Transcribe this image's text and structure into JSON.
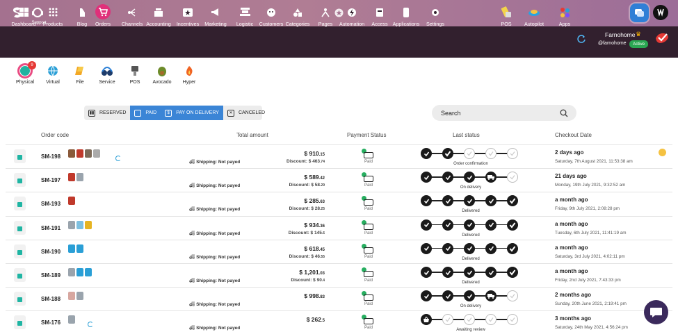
{
  "topbar": {
    "support_label": "Support"
  },
  "nav": {
    "items": [
      {
        "label": "Dashboard",
        "icon": "dashboard-icon"
      },
      {
        "label": "Products",
        "icon": "products-icon"
      },
      {
        "label": "Blog",
        "icon": "blog-icon"
      },
      {
        "label": "Orders",
        "icon": "orders-cart-icon",
        "active": true
      },
      {
        "label": "Channels",
        "icon": "channels-icon"
      },
      {
        "label": "Accounting",
        "icon": "accounting-icon"
      },
      {
        "label": "Incentives",
        "icon": "incentives-icon"
      },
      {
        "label": "Marketing",
        "icon": "marketing-icon"
      },
      {
        "label": "Logistic",
        "icon": "logistic-icon"
      },
      {
        "label": "Customers",
        "icon": "customers-icon"
      },
      {
        "label": "Categories",
        "icon": "categories-icon"
      },
      {
        "label": "Pages",
        "icon": "pages-icon"
      },
      {
        "label": "Automation",
        "icon": "automation-icon"
      },
      {
        "label": "Access",
        "icon": "access-icon"
      },
      {
        "label": "Applications",
        "icon": "applications-icon"
      },
      {
        "label": "Settings",
        "icon": "settings-icon"
      },
      {
        "label": "POS",
        "icon": "pos-icon"
      },
      {
        "label": "Autopilot",
        "icon": "autopilot-icon"
      },
      {
        "label": "Apps",
        "icon": "apps-icon"
      }
    ],
    "accent": "#e0307a"
  },
  "user": {
    "name": "Farnohome",
    "handle": "@farnohome",
    "status": "Active"
  },
  "sub_nav": {
    "items": [
      {
        "label": "Physical",
        "badge": "9"
      },
      {
        "label": "Virtual"
      },
      {
        "label": "File"
      },
      {
        "label": "Service"
      },
      {
        "label": "POS"
      },
      {
        "label": "Avocado"
      },
      {
        "label": "Hyper"
      }
    ]
  },
  "filters": {
    "reserved": "RESERVED",
    "paid": "PAID",
    "pay_on_delivery": "PAY ON DELIVERY",
    "canceled": "CANCELED"
  },
  "search": {
    "placeholder": "Search"
  },
  "table": {
    "headers": {
      "order_code": "Order code",
      "total_amount": "Total amount",
      "payment_status": "Payment Status",
      "last_status": "Last status",
      "checkout_date": "Checkout Date"
    },
    "rows": [
      {
        "code": "SM-198",
        "shipping_label": "Shipping:",
        "shipping_value": "Not payed",
        "amount": "$ 910",
        "amount_cents": ".15",
        "discount": "Discount: $ 463",
        "discount_cents": ".74",
        "payment": "Paid",
        "status_label": "Order confirmation",
        "steps": [
          "done",
          "done-check",
          "todo",
          "todo",
          "todo"
        ],
        "ago": "2 days ago",
        "date": "Saturday, 7th August 2021, 11:53:38 am"
      },
      {
        "code": "SM-197",
        "shipping_label": "Shipping:",
        "shipping_value": "Not payed",
        "amount": "$ 589",
        "amount_cents": ".42",
        "discount": "Discount: $ 58",
        "discount_cents": ".29",
        "payment": "Paid",
        "status_label": "On delivery",
        "steps": [
          "done",
          "done",
          "done",
          "truck",
          "todo"
        ],
        "ago": "21 days ago",
        "date": "Monday, 19th July 2021, 9:32:52 am"
      },
      {
        "code": "SM-193",
        "shipping_label": "Shipping:",
        "shipping_value": "Not payed",
        "amount": "$ 285",
        "amount_cents": ".63",
        "discount": "Discount: $ 28",
        "discount_cents": ".25",
        "payment": "Paid",
        "status_label": "Delivered",
        "steps": [
          "done",
          "done",
          "done",
          "done",
          "done-check"
        ],
        "ago": "a month ago",
        "date": "Friday, 9th July 2021, 2:08:28 pm"
      },
      {
        "code": "SM-191",
        "shipping_label": "Shipping:",
        "shipping_value": "Not payed",
        "amount": "$ 934",
        "amount_cents": ".36",
        "discount": "Discount: $ 145",
        "discount_cents": ".6",
        "payment": "Paid",
        "status_label": "Delivered",
        "steps": [
          "done",
          "done",
          "done",
          "done",
          "done-check"
        ],
        "ago": "a month ago",
        "date": "Tuesday, 6th July 2021, 11:41:19 am"
      },
      {
        "code": "SM-190",
        "shipping_label": "Shipping:",
        "shipping_value": "Not payed",
        "amount": "$ 618",
        "amount_cents": ".45",
        "discount": "Discount: $ 46",
        "discount_cents": ".55",
        "payment": "Paid",
        "status_label": "Delivered",
        "steps": [
          "done",
          "done",
          "done",
          "done",
          "done-check"
        ],
        "ago": "a month ago",
        "date": "Saturday, 3rd July 2021, 4:02:11 pm"
      },
      {
        "code": "SM-189",
        "shipping_label": "Shipping:",
        "shipping_value": "Not payed",
        "amount": "$ 1,201",
        "amount_cents": ".03",
        "discount": "Discount: $ 90",
        "discount_cents": ".4",
        "payment": "Paid",
        "status_label": "Delivered",
        "steps": [
          "done",
          "done",
          "done",
          "done",
          "done-check"
        ],
        "ago": "a month ago",
        "date": "Friday, 2nd July 2021, 7:43:33 pm"
      },
      {
        "code": "SM-188",
        "shipping_label": "Shipping:",
        "shipping_value": "Not payed",
        "amount": "$ 998",
        "amount_cents": ".83",
        "discount": "",
        "discount_cents": "",
        "payment": "Paid",
        "status_label": "On delivery",
        "steps": [
          "done",
          "done",
          "done",
          "truck",
          "todo"
        ],
        "ago": "2 months ago",
        "date": "Sunday, 20th June 2021, 2:19:41 pm"
      },
      {
        "code": "SM-176",
        "shipping_label": "Shipping:",
        "shipping_value": "Not payed",
        "amount": "$ 262",
        "amount_cents": ".5",
        "discount": "",
        "discount_cents": "",
        "payment": "Paid",
        "status_label": "Awaiting review",
        "steps": [
          "basket",
          "todo",
          "todo",
          "todo",
          "todo"
        ],
        "ago": "3 months ago",
        "date": "Saturday, 24th May 2021, 4:56:24 pm"
      }
    ]
  }
}
